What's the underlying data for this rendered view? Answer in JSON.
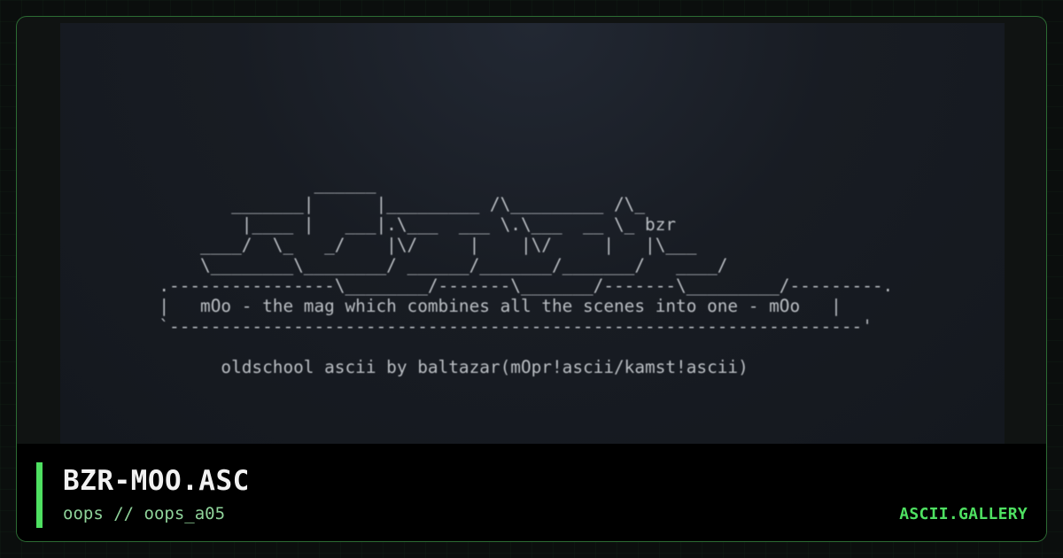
{
  "artwork": {
    "ascii": "                 ______\n         _______|      |_________ /\\_________ /\\_\n          |____ |   ___|.\\___  ___ \\.\\___  __ \\_ bzr\n      ____/  \\_   _/    |\\/     |    |\\/     |   |\\___\n      \\________\\________/ ______/_______/_______/   ____/\n  .----------------\\________/-------\\_______/-------\\_________/---------.\n  |   mOo - the mag which combines all the scenes into one - mOo   |\n  `-------------------------------------------------------------------'\n\n        oldschool ascii by baltazar(mOpr!ascii/kamst!ascii)"
  },
  "footer": {
    "title": "BZR-MOO.ASC",
    "subtitle": "oops // oops_a05",
    "brand": "ASCII.GALLERY"
  },
  "colors": {
    "accent": "#4ee061",
    "subtitle": "#8fd39a",
    "title": "#f2f2f2",
    "art_text": "#c9cdd2",
    "art_background": "#181c23"
  }
}
